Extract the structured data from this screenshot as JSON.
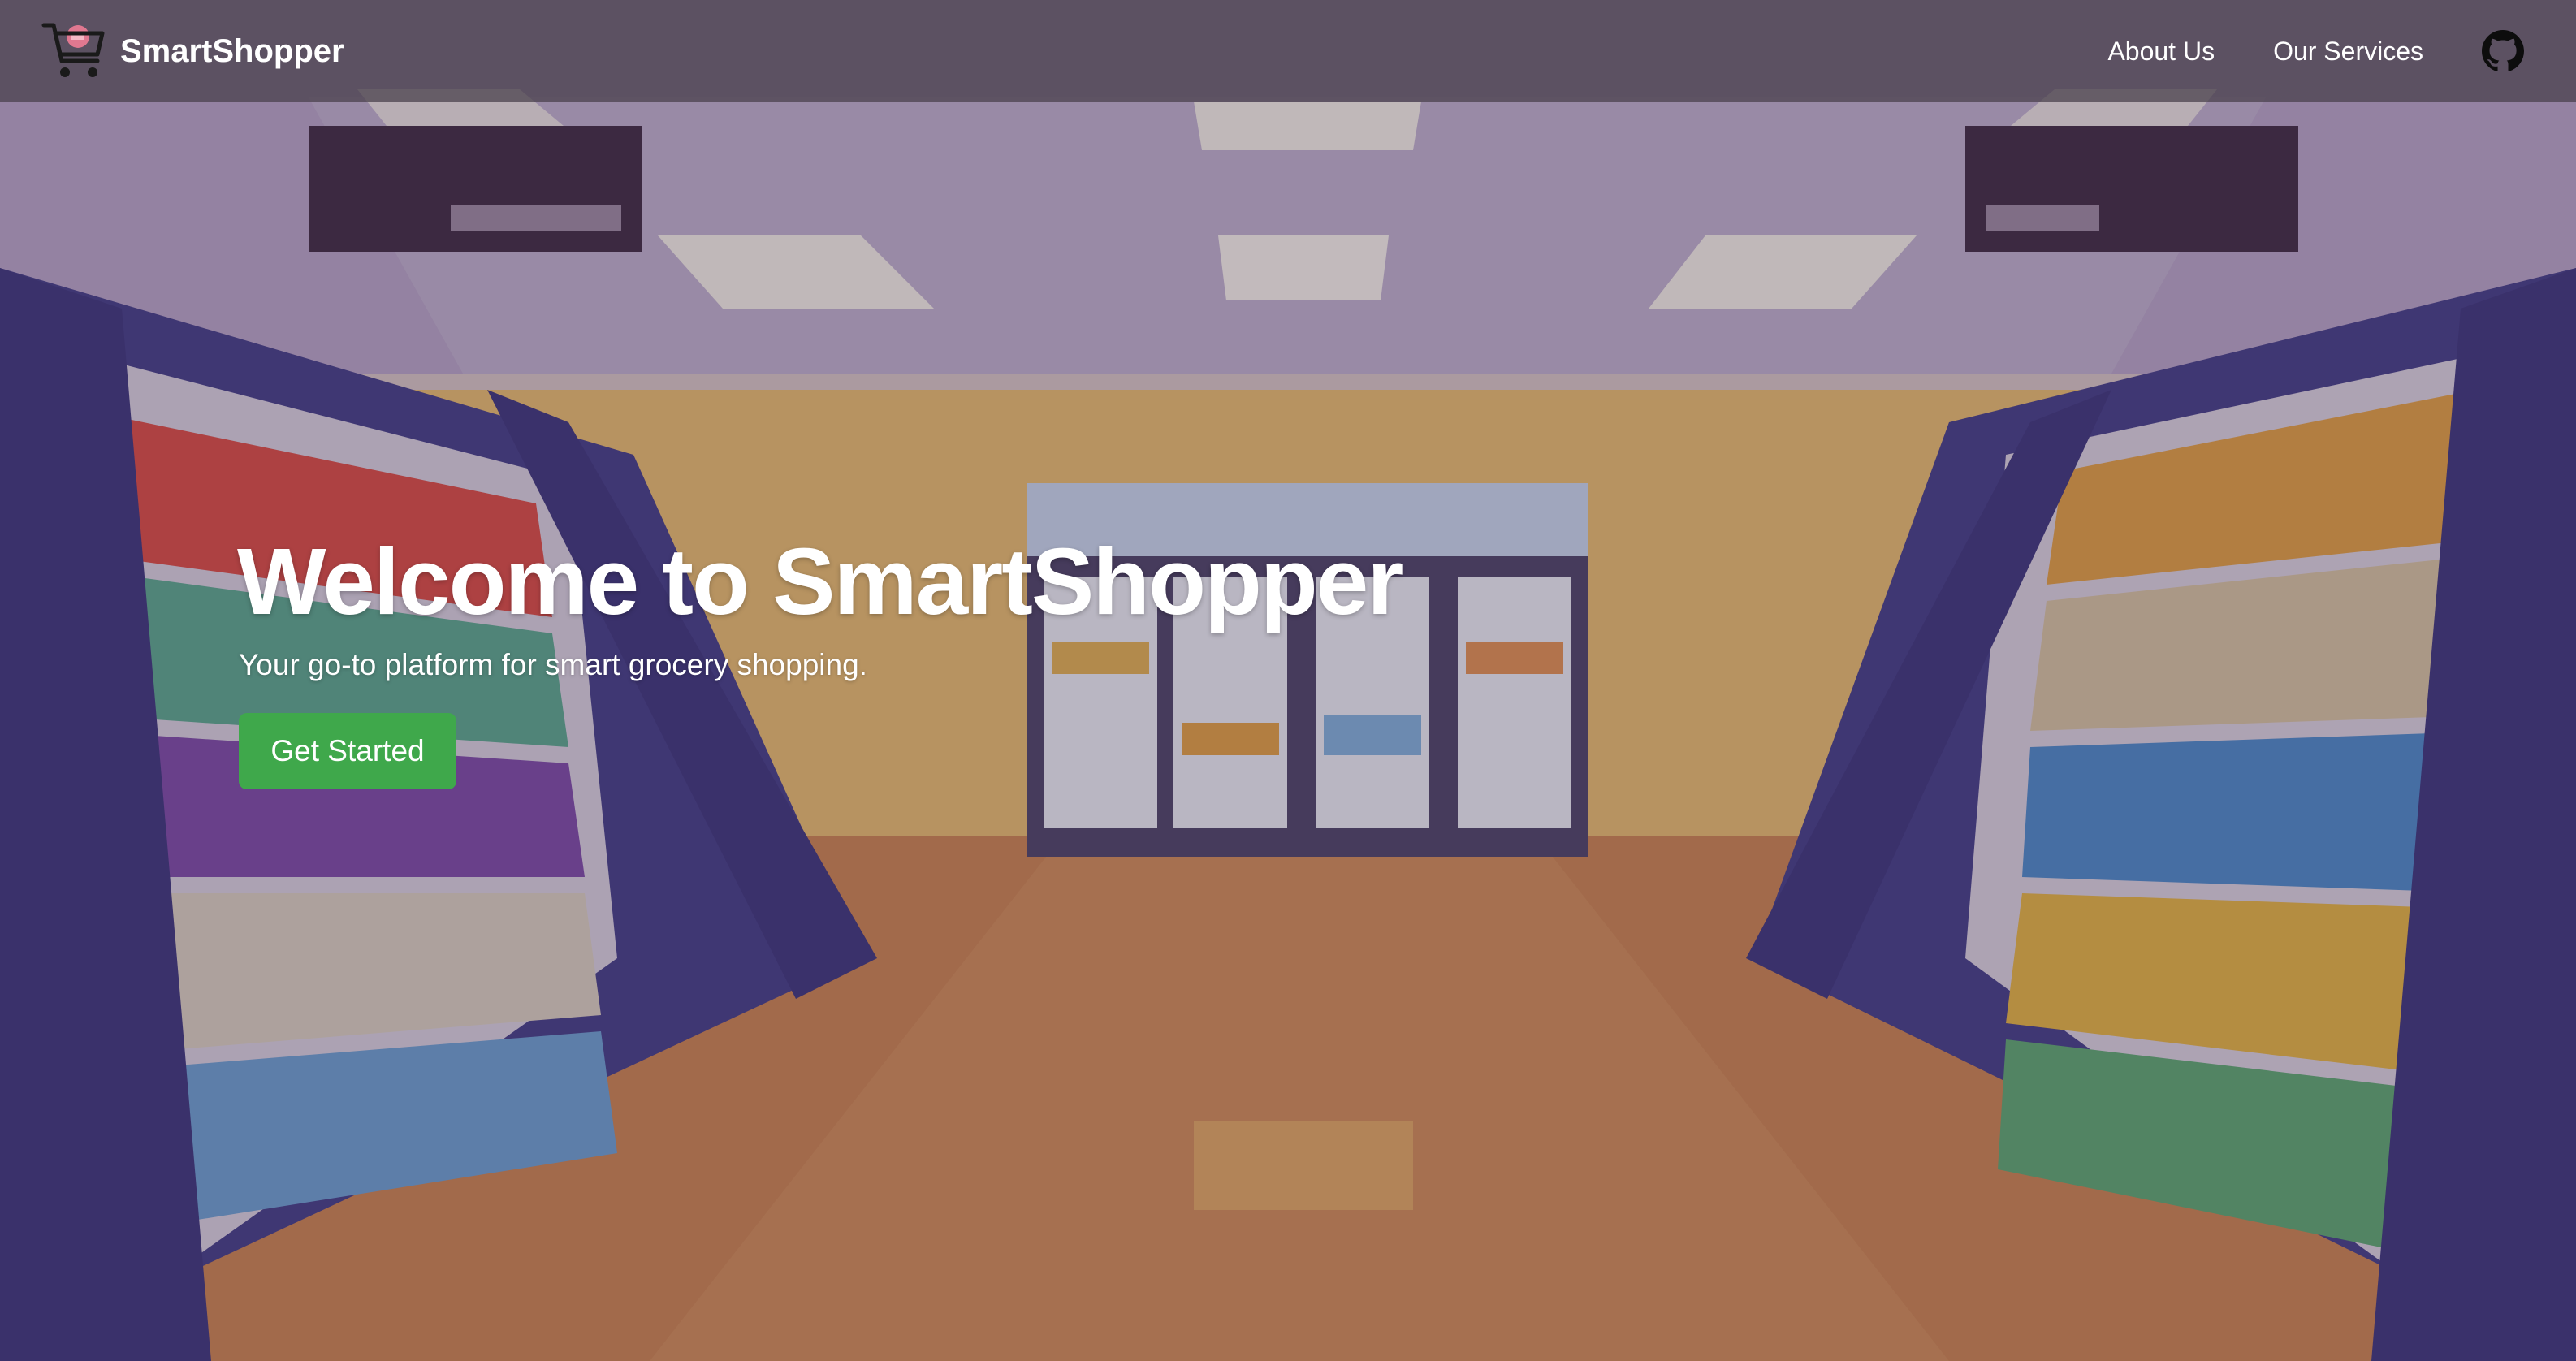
{
  "navbar": {
    "brand_name": "SmartShopper",
    "brand_icon": "shopping-cart-icon",
    "links": [
      {
        "label": "About Us"
      },
      {
        "label": "Our Services"
      }
    ],
    "github_icon": "github-icon"
  },
  "hero": {
    "title": "Welcome to SmartShopper",
    "subtitle": "Your go-to platform for smart grocery shopping.",
    "cta_label": "Get Started"
  },
  "colors": {
    "navbar_bg": "#463e4a",
    "cta_bg": "#3fa84b",
    "text": "#ffffff"
  }
}
